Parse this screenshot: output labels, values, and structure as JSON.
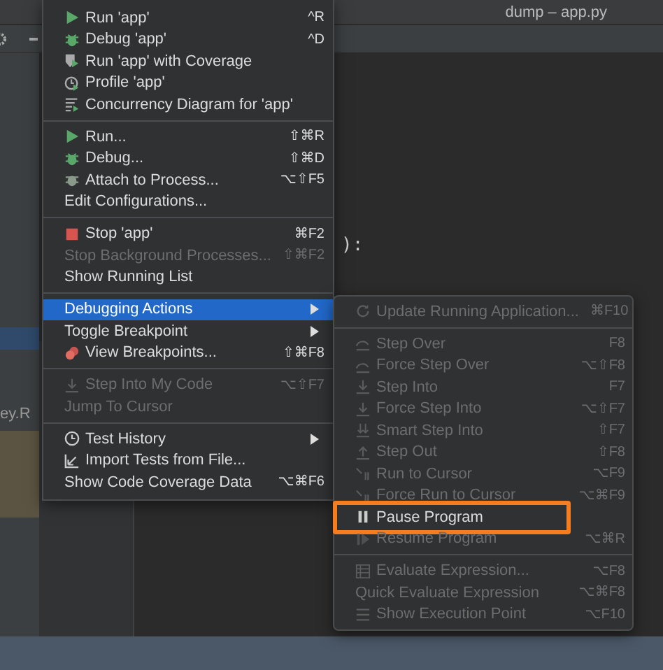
{
  "window": {
    "title": "dump – app.py"
  },
  "side_panel": {
    "fragment": "ey.R"
  },
  "editor": {
    "fragment": "):"
  },
  "menu": {
    "items": [
      {
        "kind": "run",
        "label": "Run 'app'",
        "shortcut": "^R",
        "disabled": false,
        "selected": false
      },
      {
        "kind": "debug",
        "label": "Debug 'app'",
        "shortcut": "^D",
        "disabled": false,
        "selected": false
      },
      {
        "kind": "coverage",
        "label": "Run 'app' with Coverage",
        "disabled": false,
        "selected": false
      },
      {
        "kind": "profile",
        "label": "Profile 'app'",
        "disabled": false,
        "selected": false
      },
      {
        "kind": "concurrency",
        "label": "Concurrency Diagram for 'app'",
        "disabled": false,
        "selected": false
      },
      {
        "kind": "separator"
      },
      {
        "kind": "run",
        "label": "Run...",
        "shortcut": "⇧⌘R",
        "disabled": false,
        "selected": false
      },
      {
        "kind": "debug",
        "label": "Debug...",
        "shortcut": "⇧⌘D",
        "disabled": false,
        "selected": false
      },
      {
        "kind": "attach",
        "label": "Attach to Process...",
        "shortcut": "⌥⇧F5",
        "disabled": false,
        "selected": false
      },
      {
        "kind": "plain",
        "label": "Edit Configurations...",
        "disabled": false,
        "selected": false
      },
      {
        "kind": "separator"
      },
      {
        "kind": "stop",
        "label": "Stop 'app'",
        "shortcut": "⌘F2",
        "disabled": false,
        "selected": false
      },
      {
        "kind": "plain",
        "label": "Stop Background Processes...",
        "shortcut": "⇧⌘F2",
        "disabled": true,
        "selected": false
      },
      {
        "kind": "plain",
        "label": "Show Running List",
        "disabled": false,
        "selected": false
      },
      {
        "kind": "separator"
      },
      {
        "kind": "plain",
        "label": "Debugging Actions",
        "submenu": true,
        "disabled": false,
        "selected": true
      },
      {
        "kind": "plain",
        "label": "Toggle Breakpoint",
        "submenu": true,
        "disabled": false,
        "selected": false
      },
      {
        "kind": "breakpoints",
        "label": "View Breakpoints...",
        "shortcut": "⇧⌘F8",
        "disabled": false,
        "selected": false
      },
      {
        "kind": "separator"
      },
      {
        "kind": "stepinto",
        "label": "Step Into My Code",
        "shortcut": "⌥⇧F7",
        "disabled": true,
        "selected": false
      },
      {
        "kind": "plain",
        "label": "Jump To Cursor",
        "disabled": true,
        "selected": false
      },
      {
        "kind": "separator"
      },
      {
        "kind": "history",
        "label": "Test History",
        "submenu": true,
        "disabled": false,
        "selected": false
      },
      {
        "kind": "import",
        "label": "Import Tests from File...",
        "disabled": false,
        "selected": false
      },
      {
        "kind": "plain",
        "label": "Show Code Coverage Data",
        "shortcut": "⌥⌘F6",
        "disabled": false,
        "selected": false
      }
    ]
  },
  "submenu": {
    "items": [
      {
        "kind": "update",
        "label": "Update Running Application...",
        "shortcut": "⌘F10",
        "disabled": true,
        "selected": false
      },
      {
        "kind": "separator"
      },
      {
        "kind": "stepover",
        "label": "Step Over",
        "shortcut": "F8",
        "disabled": true,
        "selected": false
      },
      {
        "kind": "stepover",
        "label": "Force Step Over",
        "shortcut": "⌥⇧F8",
        "disabled": true,
        "selected": false
      },
      {
        "kind": "stepinto",
        "label": "Step Into",
        "shortcut": "F7",
        "disabled": true,
        "selected": false
      },
      {
        "kind": "stepinto",
        "label": "Force Step Into",
        "shortcut": "⌥⇧F7",
        "disabled": true,
        "selected": false
      },
      {
        "kind": "smartstep",
        "label": "Smart Step Into",
        "shortcut": "⇧F7",
        "disabled": true,
        "selected": false
      },
      {
        "kind": "stepout",
        "label": "Step Out",
        "shortcut": "⇧F8",
        "disabled": true,
        "selected": false
      },
      {
        "kind": "runcursor",
        "label": "Run to Cursor",
        "shortcut": "⌥F9",
        "disabled": true,
        "selected": false
      },
      {
        "kind": "runcursor",
        "label": "Force Run to Cursor",
        "shortcut": "⌥⌘F9",
        "disabled": true,
        "selected": false
      },
      {
        "kind": "pause",
        "label": "Pause Program",
        "disabled": false,
        "selected": false,
        "highlighted": true
      },
      {
        "kind": "resume",
        "label": "Resume Program",
        "shortcut": "⌥⌘R",
        "disabled": true,
        "selected": false
      },
      {
        "kind": "separator"
      },
      {
        "kind": "evaluate",
        "label": "Evaluate Expression...",
        "shortcut": "⌥F8",
        "disabled": true,
        "selected": false
      },
      {
        "kind": "plain",
        "label": "Quick Evaluate Expression",
        "shortcut": "⌥⌘F8",
        "disabled": true,
        "selected": false
      },
      {
        "kind": "lines",
        "label": "Show Execution Point",
        "shortcut": "⌥F10",
        "disabled": true,
        "selected": false
      }
    ]
  }
}
